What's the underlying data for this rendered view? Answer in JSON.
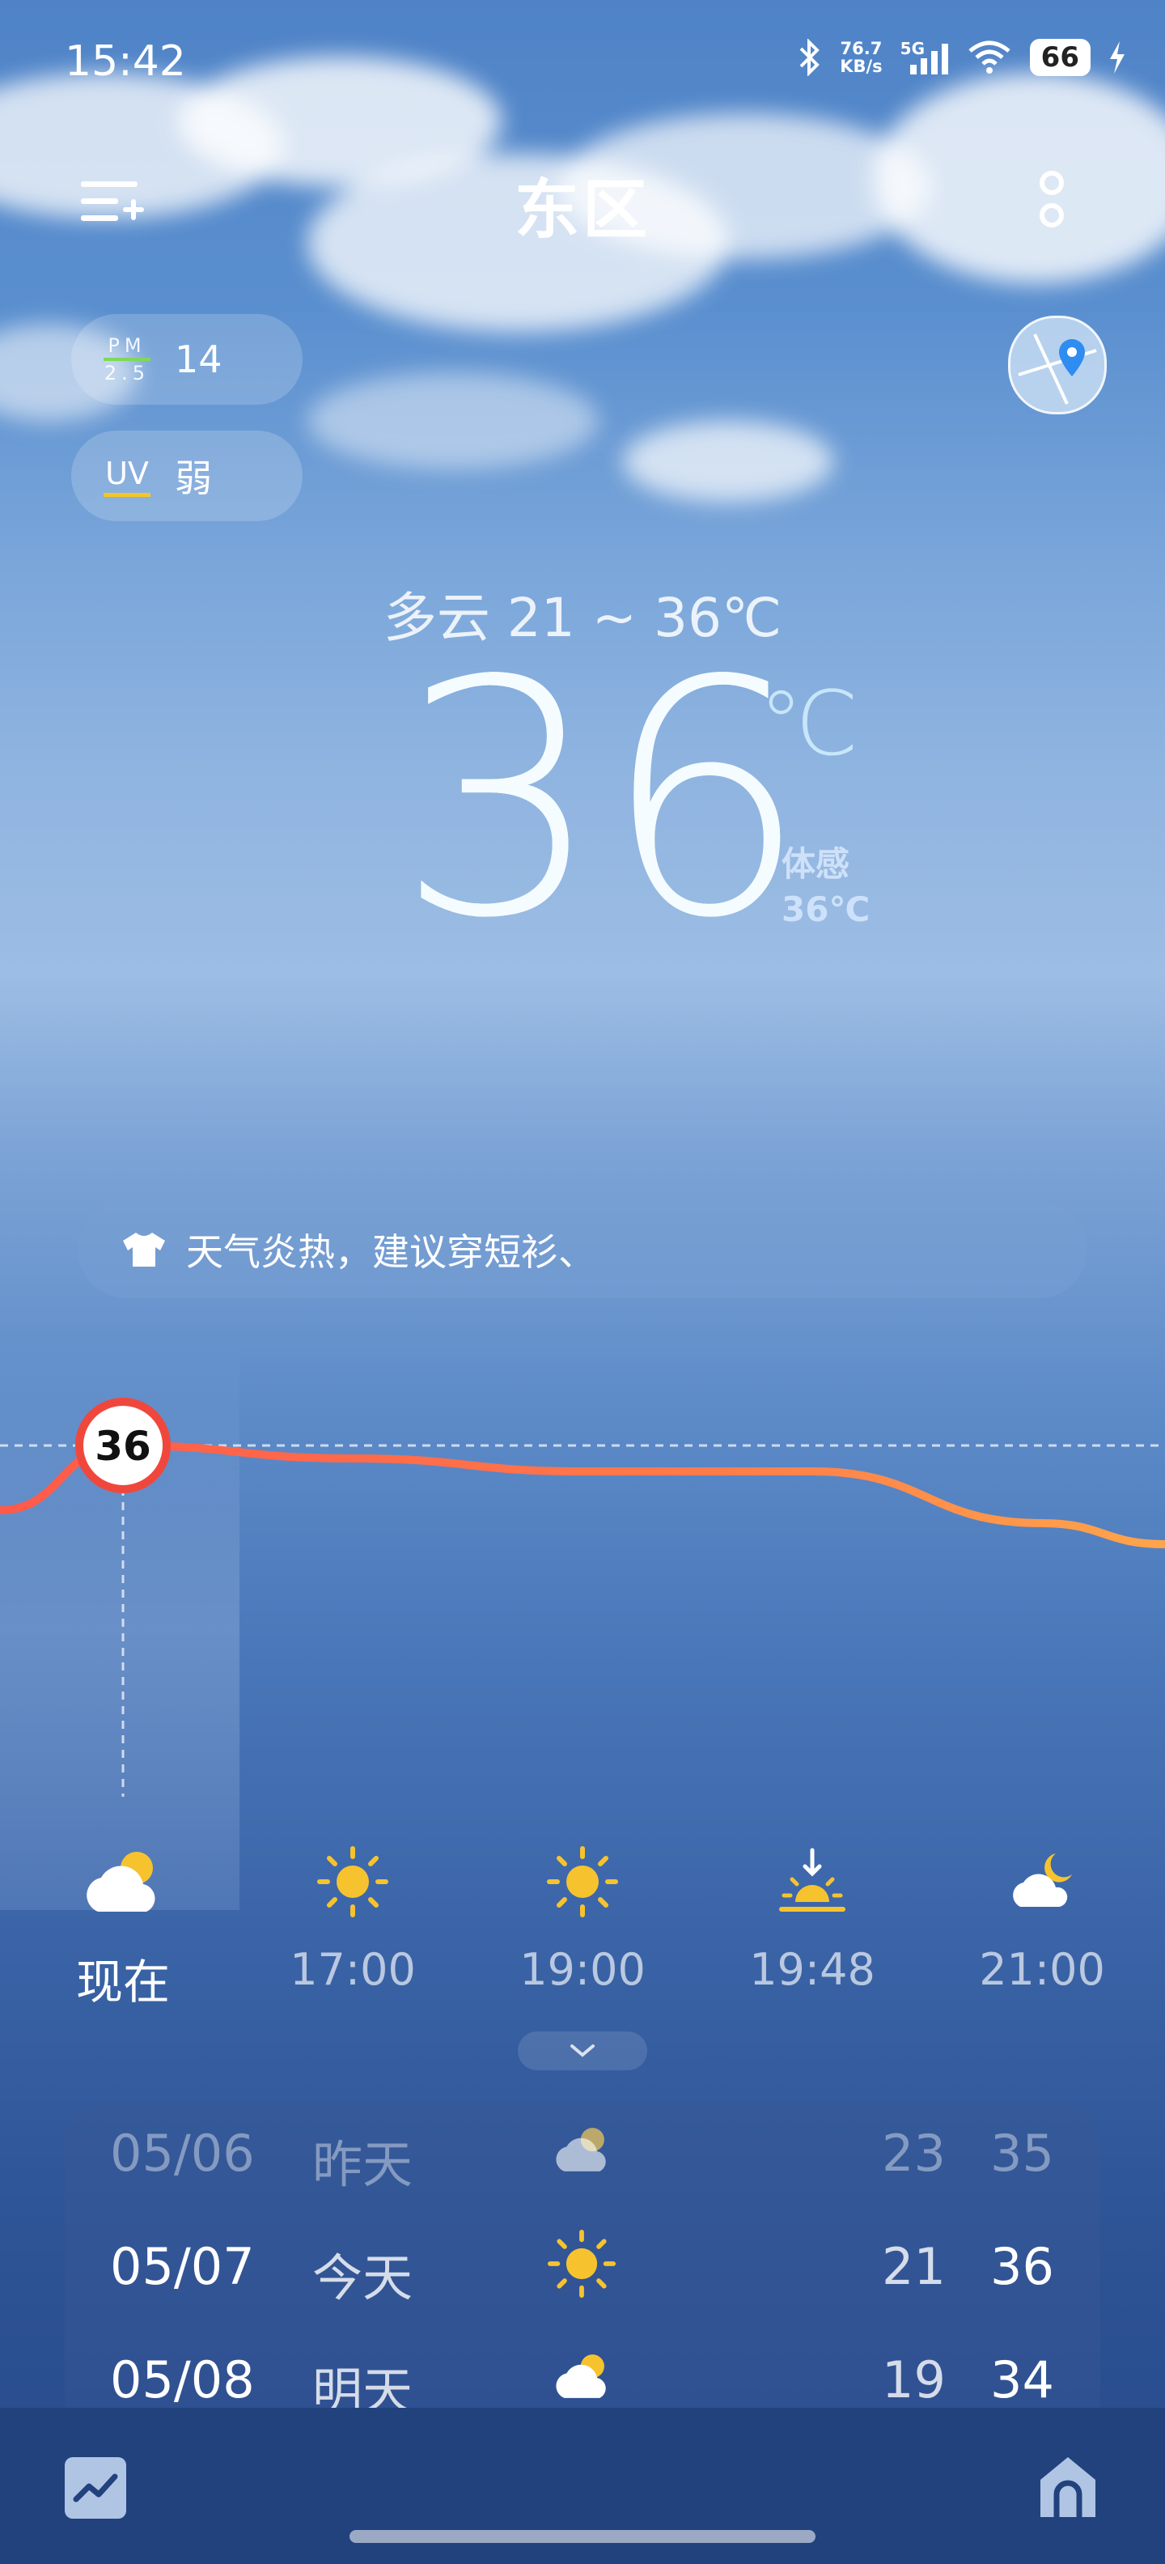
{
  "status_bar": {
    "time": "15:42",
    "net_speed_value": "76.7",
    "net_speed_unit": "KB/s",
    "network_type": "5G",
    "battery": "66",
    "icons": [
      "bluetooth-icon",
      "signal-icon",
      "wifi-icon",
      "charging-icon"
    ]
  },
  "header": {
    "city": "东区",
    "menu_icon": "add-list-icon",
    "more_icon": "more-dots-icon",
    "map_icon": "map-pin-icon"
  },
  "air": {
    "pm_label_top": "PM",
    "pm_label_bottom": "2.5",
    "pm_value": "14",
    "uv_label": "UV",
    "uv_value": "弱"
  },
  "current": {
    "summary": "多云  21 ~ 36℃",
    "temp": "36",
    "unit": "℃",
    "feels_label": "体感",
    "feels_value": "36℃"
  },
  "advice": {
    "icon": "tshirt-icon",
    "text": "天气炎热，建议穿短衫、"
  },
  "chart_data": {
    "type": "line",
    "marker_value": "36",
    "x": [
      "现在",
      "17:00",
      "19:00",
      "19:48",
      "21:00"
    ],
    "series": [
      {
        "values": [
          36,
          35,
          34,
          34,
          30
        ]
      }
    ]
  },
  "hourly": [
    {
      "label": "现在",
      "icon": "partly-cloudy-day-icon"
    },
    {
      "label": "17:00",
      "icon": "sun-icon"
    },
    {
      "label": "19:00",
      "icon": "sun-icon"
    },
    {
      "label": "19:48",
      "icon": "sunset-icon"
    },
    {
      "label": "21:00",
      "icon": "partly-cloudy-night-icon"
    }
  ],
  "daily": [
    {
      "date": "05/06",
      "day": "昨天",
      "icon": "partly-cloudy-day-icon",
      "low": "23",
      "high": "35"
    },
    {
      "date": "05/07",
      "day": "今天",
      "icon": "sun-icon",
      "low": "21",
      "high": "36"
    },
    {
      "date": "05/08",
      "day": "明天",
      "icon": "partly-cloudy-day-icon",
      "low": "19",
      "high": "34"
    }
  ],
  "bottom": {
    "left_icon": "trend-chart-icon",
    "right_icon": "home-icon"
  }
}
